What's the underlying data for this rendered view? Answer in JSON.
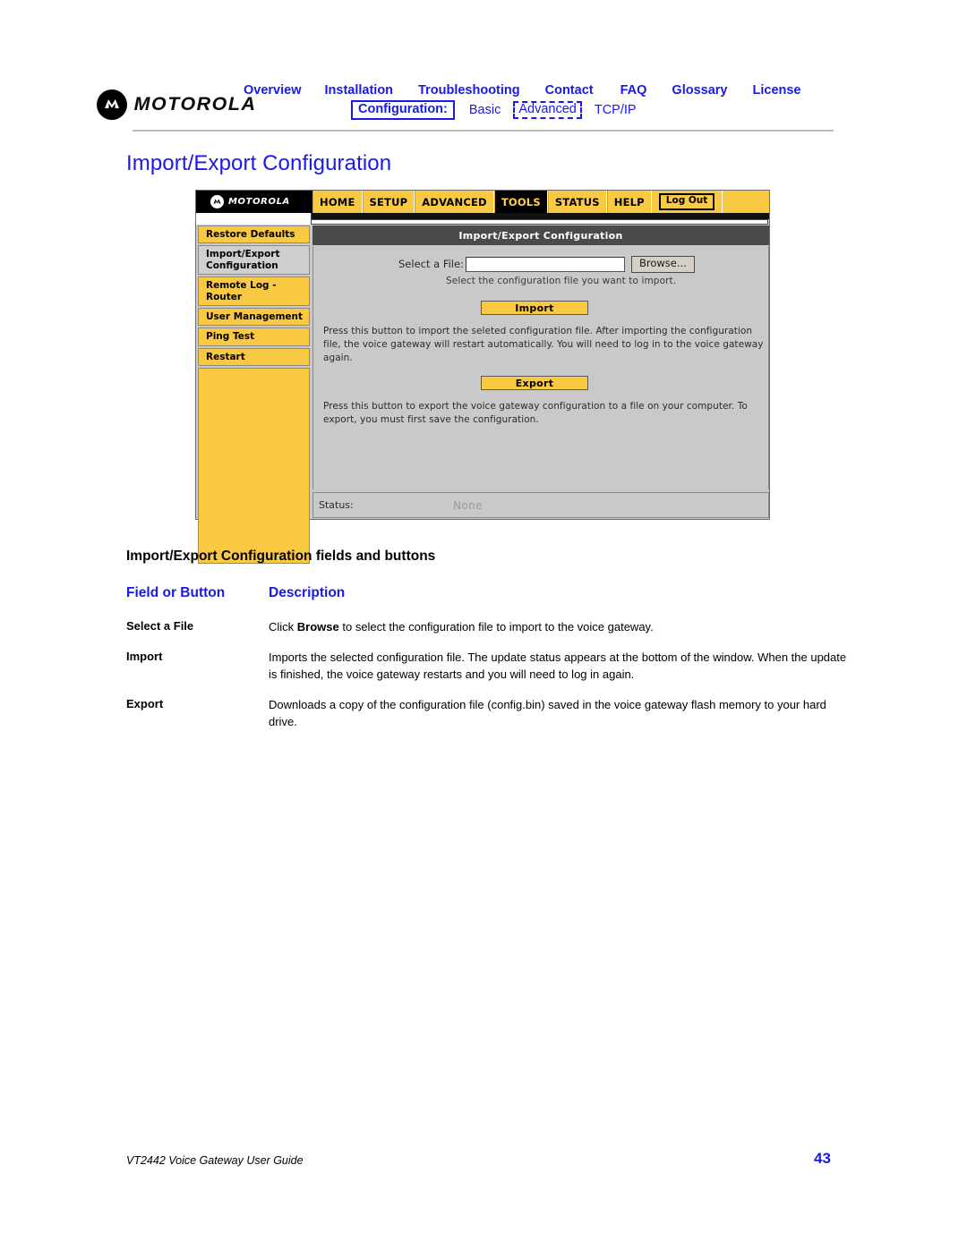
{
  "header": {
    "brand": "MOTOROLA",
    "nav_primary": [
      {
        "label": "Overview"
      },
      {
        "label": "Installation"
      },
      {
        "label": "Troubleshooting"
      },
      {
        "label": "Contact"
      },
      {
        "label": "FAQ"
      },
      {
        "label": "Glossary"
      },
      {
        "label": "License"
      }
    ],
    "nav_secondary": {
      "group_label": "Configuration:",
      "items": [
        {
          "label": "Basic",
          "boxed": false
        },
        {
          "label": "Advanced",
          "boxed": true
        },
        {
          "label": "TCP/IP",
          "boxed": false
        }
      ]
    },
    "link_color": "#1a1ae6"
  },
  "page": {
    "title": "Import/Export Configuration"
  },
  "router_ui": {
    "brand": "MOTOROLA",
    "tabs": [
      {
        "label": "HOME",
        "active": false
      },
      {
        "label": "SETUP",
        "active": false
      },
      {
        "label": "ADVANCED",
        "active": false
      },
      {
        "label": "TOOLS",
        "active": true
      },
      {
        "label": "STATUS",
        "active": false
      },
      {
        "label": "HELP",
        "active": false
      }
    ],
    "logout_label": "Log Out",
    "heading": "Import/Export Configuration",
    "sidebar": [
      {
        "label": "Restore Defaults",
        "selected": false
      },
      {
        "label": "Import/Export Configuration",
        "selected": true
      },
      {
        "label": "Remote Log - Router",
        "selected": false
      },
      {
        "label": "User Management",
        "selected": false
      },
      {
        "label": "Ping Test",
        "selected": false
      },
      {
        "label": "Restart",
        "selected": false
      }
    ],
    "file_field": {
      "label": "Select a File:",
      "value": "",
      "placeholder": "",
      "browse_label": "Browse...",
      "hint": "Select the configuration file you want to import."
    },
    "import_button": "Import",
    "import_paragraph": "Press this button to import the seleted configuration file. After importing the configuration file, the voice gateway will restart automatically. You will need to log in to the voice gateway again.",
    "export_button": "Export",
    "export_paragraph": "Press this button to export the voice gateway configuration to a file on your computer. To export, you must first save the configuration.",
    "status": {
      "label": "Status:",
      "value": "None"
    },
    "accent_color": "#fac943"
  },
  "table": {
    "caption": "Import/Export Configuration fields and buttons",
    "headers": {
      "field": "Field or Button",
      "description": "Description"
    },
    "rows": [
      {
        "field": "Select a File",
        "desc_pre": "Click ",
        "desc_bold": "Browse",
        "desc_post": " to select the configuration file to import to the voice gateway."
      },
      {
        "field": "Import",
        "desc_pre": "Imports the selected configuration file. The update status appears at the bottom of the window. When the update is finished, the voice gateway restarts and you will need to log in again.",
        "desc_bold": "",
        "desc_post": ""
      },
      {
        "field": "Export",
        "desc_pre": "Downloads a copy of the configuration file (config.bin) saved in the voice gateway flash memory to your hard drive.",
        "desc_bold": "",
        "desc_post": ""
      }
    ]
  },
  "footer": {
    "document_title": "VT2442 Voice Gateway User Guide",
    "page_number": "43"
  }
}
